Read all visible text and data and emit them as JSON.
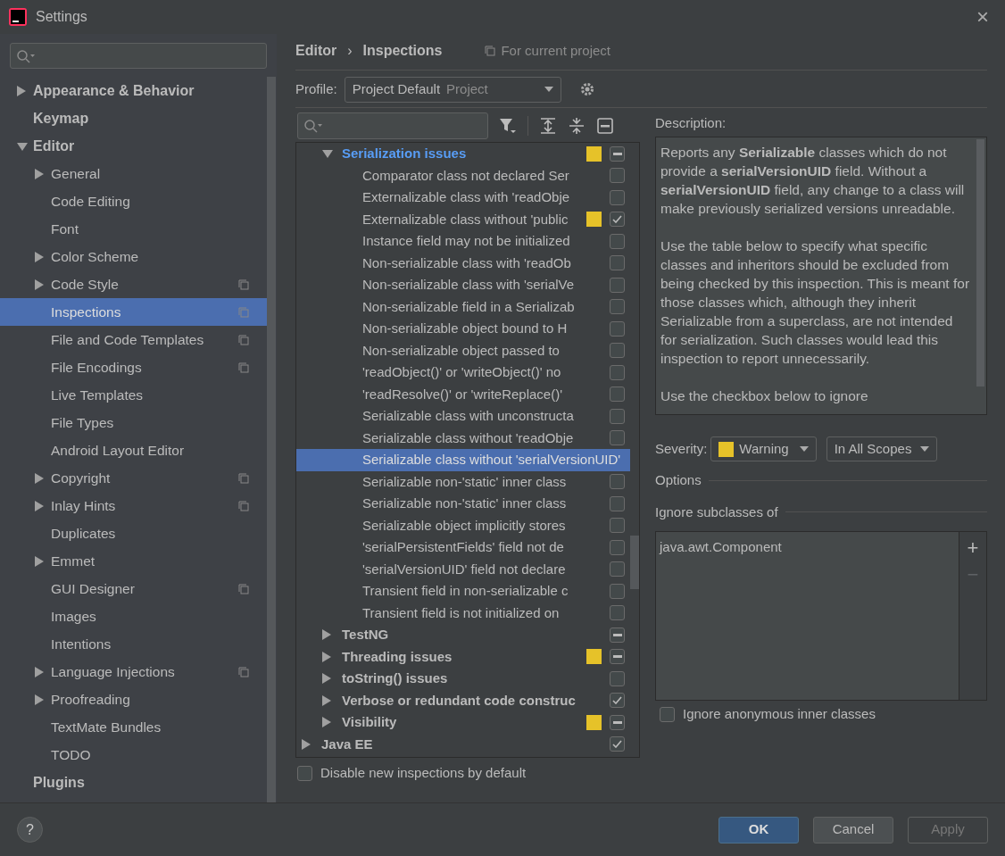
{
  "window": {
    "title": "Settings",
    "close": "×"
  },
  "sidebar": {
    "items": [
      {
        "label": "Appearance & Behavior",
        "bold": true,
        "expanded": false,
        "selected": false,
        "project": false
      },
      {
        "label": "Keymap",
        "bold": true,
        "selected": false,
        "project": false
      },
      {
        "label": "Editor",
        "bold": true,
        "expanded": true,
        "selected": false,
        "project": false,
        "children": [
          {
            "label": "General",
            "expanded": false,
            "selected": false,
            "project": false
          },
          {
            "label": "Code Editing",
            "selected": false,
            "project": false
          },
          {
            "label": "Font",
            "selected": false,
            "project": false
          },
          {
            "label": "Color Scheme",
            "expanded": false,
            "selected": false,
            "project": false
          },
          {
            "label": "Code Style",
            "expanded": false,
            "selected": false,
            "project": true
          },
          {
            "label": "Inspections",
            "selected": true,
            "project": true
          },
          {
            "label": "File and Code Templates",
            "selected": false,
            "project": true
          },
          {
            "label": "File Encodings",
            "selected": false,
            "project": true
          },
          {
            "label": "Live Templates",
            "selected": false,
            "project": false
          },
          {
            "label": "File Types",
            "selected": false,
            "project": false
          },
          {
            "label": "Android Layout Editor",
            "selected": false,
            "project": false
          },
          {
            "label": "Copyright",
            "expanded": false,
            "selected": false,
            "project": true
          },
          {
            "label": "Inlay Hints",
            "expanded": false,
            "selected": false,
            "project": true
          },
          {
            "label": "Duplicates",
            "selected": false,
            "project": false
          },
          {
            "label": "Emmet",
            "expanded": false,
            "selected": false,
            "project": false
          },
          {
            "label": "GUI Designer",
            "selected": false,
            "project": true
          },
          {
            "label": "Images",
            "selected": false,
            "project": false
          },
          {
            "label": "Intentions",
            "selected": false,
            "project": false
          },
          {
            "label": "Language Injections",
            "expanded": false,
            "selected": false,
            "project": true
          },
          {
            "label": "Proofreading",
            "expanded": false,
            "selected": false,
            "project": false
          },
          {
            "label": "TextMate Bundles",
            "selected": false,
            "project": false
          },
          {
            "label": "TODO",
            "selected": false,
            "project": false
          }
        ]
      },
      {
        "label": "Plugins",
        "bold": true,
        "selected": false,
        "project": false
      }
    ]
  },
  "breadcrumb": {
    "parent": "Editor",
    "separator": "›",
    "current": "Inspections",
    "scope": "For current project"
  },
  "profile": {
    "label": "Profile:",
    "value": "Project Default",
    "value_hint": "Project"
  },
  "tree": [
    {
      "label": "Serialization issues",
      "kind": "group",
      "expanded": true,
      "selected": false,
      "color": "#e6c229",
      "partial": true,
      "children": [
        {
          "label": "Comparator class not declared Ser",
          "selected": false,
          "checked": false
        },
        {
          "label": "Externalizable class with 'readObje",
          "selected": false,
          "checked": false
        },
        {
          "label": "Externalizable class without 'public",
          "selected": false,
          "color": "#e6c229",
          "checked": true
        },
        {
          "label": "Instance field may not be initialized",
          "selected": false,
          "checked": false
        },
        {
          "label": "Non-serializable class with 'readOb",
          "selected": false,
          "checked": false
        },
        {
          "label": "Non-serializable class with 'serialVe",
          "selected": false,
          "checked": false
        },
        {
          "label": "Non-serializable field in a Serializab",
          "selected": false,
          "checked": false
        },
        {
          "label": "Non-serializable object bound to H",
          "selected": false,
          "checked": false
        },
        {
          "label": "Non-serializable object passed to",
          "selected": false,
          "checked": false
        },
        {
          "label": "'readObject()' or 'writeObject()' no",
          "selected": false,
          "checked": false
        },
        {
          "label": "'readResolve()' or 'writeReplace()'",
          "selected": false,
          "checked": false
        },
        {
          "label": "Serializable class with unconstructa",
          "selected": false,
          "checked": false
        },
        {
          "label": "Serializable class without 'readObje",
          "selected": false,
          "checked": false
        },
        {
          "label": "Serializable class without 'serialVersionUID'",
          "selected": true
        },
        {
          "label": "Serializable non-'static' inner class",
          "selected": false,
          "checked": false
        },
        {
          "label": "Serializable non-'static' inner class",
          "selected": false,
          "checked": false
        },
        {
          "label": "Serializable object implicitly stores",
          "selected": false,
          "checked": false
        },
        {
          "label": "'serialPersistentFields' field not de",
          "selected": false,
          "checked": false
        },
        {
          "label": "'serialVersionUID' field not declare",
          "selected": false,
          "checked": false
        },
        {
          "label": "Transient field in non-serializable c",
          "selected": false,
          "checked": false
        },
        {
          "label": "Transient field is not initialized on",
          "selected": false,
          "checked": false
        }
      ]
    },
    {
      "label": "TestNG",
      "kind": "group",
      "expanded": false,
      "selected": false,
      "partial": true
    },
    {
      "label": "Threading issues",
      "kind": "group",
      "expanded": false,
      "selected": false,
      "color": "#e6c229",
      "partial": true
    },
    {
      "label": "toString() issues",
      "kind": "group",
      "expanded": false,
      "selected": false,
      "checked": false
    },
    {
      "label": "Verbose or redundant code construc",
      "kind": "group",
      "expanded": false,
      "selected": false,
      "checked": true
    },
    {
      "label": "Visibility",
      "kind": "group",
      "expanded": false,
      "selected": false,
      "color": "#e6c229",
      "partial": true
    },
    {
      "label": "Java EE",
      "kind": "top",
      "expanded": false,
      "selected": false,
      "checked": true
    }
  ],
  "disable_new": {
    "label": "Disable new inspections by default",
    "checked": false
  },
  "description": {
    "label": "Description:",
    "paragraphs": [
      "Reports any **Serializable** classes which do not provide a **serialVersionUID** field. Without a **serialVersionUID** field, any change to a class will make previously serialized versions unreadable.",
      "Use the table below to specify what specific classes and inheritors should be excluded from being checked by this inspection. This is meant for those classes which, although they inherit Serializable from a superclass, are not intended for serialization. Such classes would lead this inspection to report unnecessarily.",
      "Use the checkbox below to ignore"
    ]
  },
  "severity": {
    "label": "Severity:",
    "value": "Warning",
    "color": "#e6c229",
    "scope": "In All Scopes"
  },
  "options": {
    "title": "Options",
    "ignore_title": "Ignore subclasses of",
    "classes": [
      "java.awt.Component"
    ],
    "add": "+",
    "remove": "−",
    "remove_disabled": true,
    "anonymous": {
      "label": "Ignore anonymous inner classes",
      "checked": false
    }
  },
  "buttons": [
    {
      "label": "OK",
      "kind": "primary",
      "disabled": false
    },
    {
      "label": "Cancel",
      "kind": "normal",
      "disabled": false
    },
    {
      "label": "Apply",
      "kind": "normal",
      "disabled": true
    }
  ],
  "help": "?"
}
